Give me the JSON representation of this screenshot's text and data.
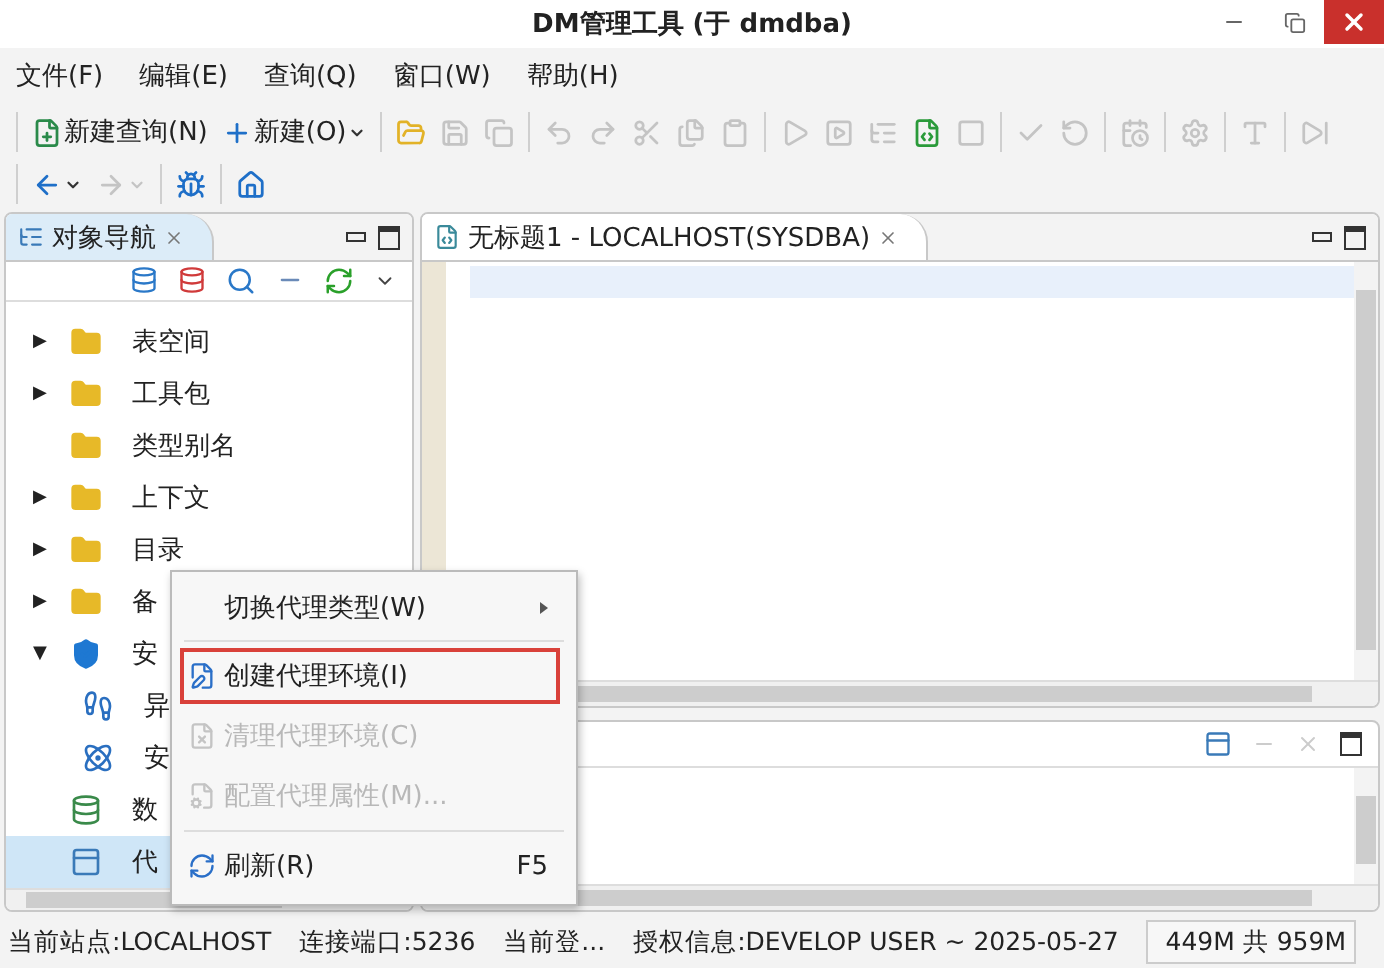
{
  "window": {
    "title": "DM管理工具 (于 dmdba)"
  },
  "menu_bar": [
    "文件(F)",
    "编辑(E)",
    "查询(Q)",
    "窗口(W)",
    "帮助(H)"
  ],
  "toolbar": [
    [
      [
        {
          "kind": "new-query",
          "label": "新建查询(N)",
          "disabled": false
        },
        {
          "kind": "new",
          "label": "新建(O)",
          "dropdown": true,
          "disabled": false
        }
      ],
      [
        {
          "kind": "open",
          "disabled": false
        },
        {
          "kind": "save",
          "disabled": true
        },
        {
          "kind": "save-all",
          "disabled": true
        }
      ],
      [
        {
          "kind": "undo",
          "disabled": true
        },
        {
          "kind": "redo",
          "disabled": true
        },
        {
          "kind": "cut",
          "disabled": true
        },
        {
          "kind": "copy",
          "disabled": true
        },
        {
          "kind": "paste",
          "disabled": true
        }
      ],
      [
        {
          "kind": "run",
          "disabled": true
        },
        {
          "kind": "run-part",
          "disabled": true
        },
        {
          "kind": "explain",
          "disabled": true
        },
        {
          "kind": "run-script",
          "disabled": false
        },
        {
          "kind": "stop",
          "disabled": true
        }
      ],
      [
        {
          "kind": "commit",
          "disabled": true
        },
        {
          "kind": "rollback",
          "disabled": true
        }
      ],
      [
        {
          "kind": "history",
          "disabled": true
        }
      ],
      [
        {
          "kind": "settings",
          "disabled": true
        }
      ],
      [
        {
          "kind": "format",
          "disabled": true
        }
      ],
      [
        {
          "kind": "debug",
          "disabled": true
        }
      ]
    ],
    [
      [
        {
          "kind": "back",
          "dropdown": true,
          "disabled": false
        },
        {
          "kind": "forward",
          "dropdown": true,
          "disabled": true
        }
      ],
      [
        {
          "kind": "bug",
          "disabled": false
        }
      ],
      [
        {
          "kind": "home",
          "disabled": false
        }
      ]
    ]
  ],
  "navigator": {
    "title": "对象导航",
    "tree": [
      {
        "label": "表空间",
        "kind": "folder",
        "toggle": "▶",
        "selected": false
      },
      {
        "label": "工具包",
        "kind": "folder",
        "toggle": "▶",
        "selected": false
      },
      {
        "label": "类型别名",
        "kind": "folder",
        "selected": false
      },
      {
        "label": "上下文",
        "kind": "folder",
        "toggle": "▶",
        "selected": false
      },
      {
        "label": "目录",
        "kind": "folder",
        "toggle": "▶",
        "selected": false
      },
      {
        "label": "备",
        "kind": "folder",
        "toggle": "▶",
        "selected": false
      },
      {
        "label": "安",
        "kind": "shield",
        "toggle": "▼",
        "selected": false,
        "children": [
          {
            "label": "异",
            "kind": "footprints",
            "selected": false
          },
          {
            "label": "安",
            "kind": "atom",
            "selected": false
          }
        ]
      },
      {
        "label": "数",
        "kind": "database",
        "selected": false
      },
      {
        "label": "代",
        "kind": "agent",
        "selected": true
      }
    ]
  },
  "editor": {
    "tab": "无标题1 - LOCALHOST(SYSDBA)"
  },
  "context_menu": [
    {
      "kind": "submenu",
      "label": "切换代理类型(W)",
      "disabled": false,
      "selected": false
    },
    {
      "kind": "create",
      "label": "创建代理环境(I)",
      "disabled": false,
      "selected": true
    },
    {
      "kind": "clean",
      "label": "清理代理环境(C)",
      "disabled": true,
      "selected": false
    },
    {
      "kind": "config",
      "label": "配置代理属性(M)...",
      "disabled": true,
      "selected": false
    },
    {
      "kind": "refresh",
      "label": "刷新(R)",
      "shortcut": "F5",
      "disabled": false,
      "selected": false
    }
  ],
  "status_bar": {
    "items": [
      "当前站点:LOCALHOST",
      "连接端口:5236",
      "当前登...",
      "授权信息:DEVELOP USER ~ 2025-05-27"
    ],
    "memory": "449M 共 959M"
  }
}
